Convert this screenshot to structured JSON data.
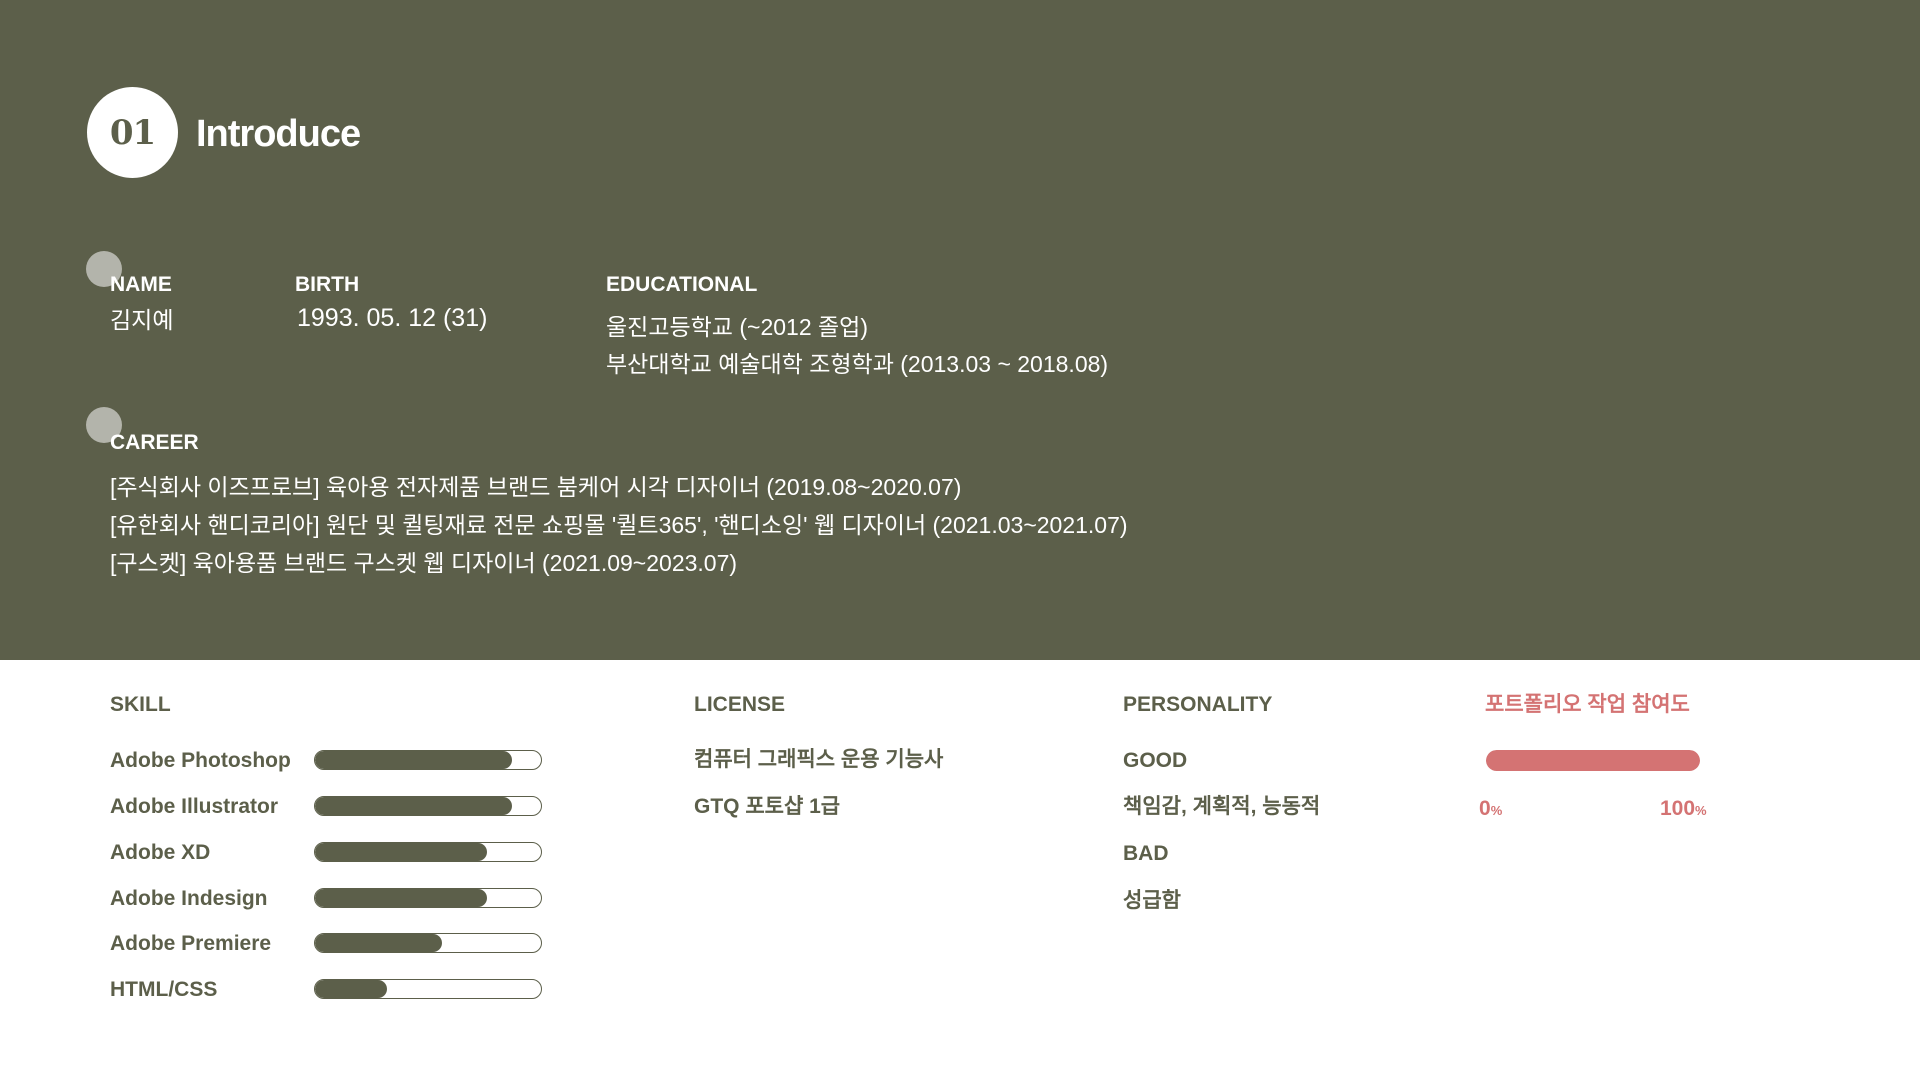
{
  "header": {
    "number": "01",
    "title": "Introduce"
  },
  "profile": {
    "name_label": "NAME",
    "name_value": "김지예",
    "birth_label": "BIRTH",
    "birth_value": "1993. 05. 12 (31)",
    "edu_label": "EDUCATIONAL",
    "edu_lines": [
      "울진고등학교 (~2012 졸업)",
      "부산대학교 예술대학 조형학과 (2013.03 ~ 2018.08)"
    ]
  },
  "career": {
    "label": "CAREER",
    "lines": [
      "[주식회사 이즈프로브] 육아용 전자제품 브랜드 붐케어 시각 디자이너 (2019.08~2020.07)",
      "[유한회사 핸디코리아] 원단 및 퀼팅재료 전문 쇼핑몰 '퀼트365', '핸디소잉' 웹 디자이너 (2021.03~2021.07)",
      "[구스켓] 육아용품 브랜드 구스켓 웹 디자이너 (2021.09~2023.07)"
    ]
  },
  "skill": {
    "label": "SKILL",
    "items": [
      {
        "name": "Adobe Photoshop",
        "level": 0.87
      },
      {
        "name": "Adobe Illustrator",
        "level": 0.87
      },
      {
        "name": "Adobe XD",
        "level": 0.76
      },
      {
        "name": "Adobe Indesign",
        "level": 0.76
      },
      {
        "name": "Adobe Premiere",
        "level": 0.56
      },
      {
        "name": "HTML/CSS",
        "level": 0.32
      }
    ]
  },
  "license": {
    "label": "LICENSE",
    "items": [
      "컴퓨터 그래픽스 운용 기능사",
      "GTQ 포토샵 1급"
    ]
  },
  "personality": {
    "label": "PERSONALITY",
    "good_label": "GOOD",
    "good_value": "책임감, 계획적, 능동적",
    "bad_label": "BAD",
    "bad_value": "성급함"
  },
  "participation": {
    "label": "포트폴리오 작업 참여도",
    "level": 1.0,
    "min_value": "0",
    "max_value": "100",
    "unit": "%"
  },
  "colors": {
    "olive": "#5c5f4a",
    "pink": "#d47373",
    "dot": "#b3b4ab"
  }
}
